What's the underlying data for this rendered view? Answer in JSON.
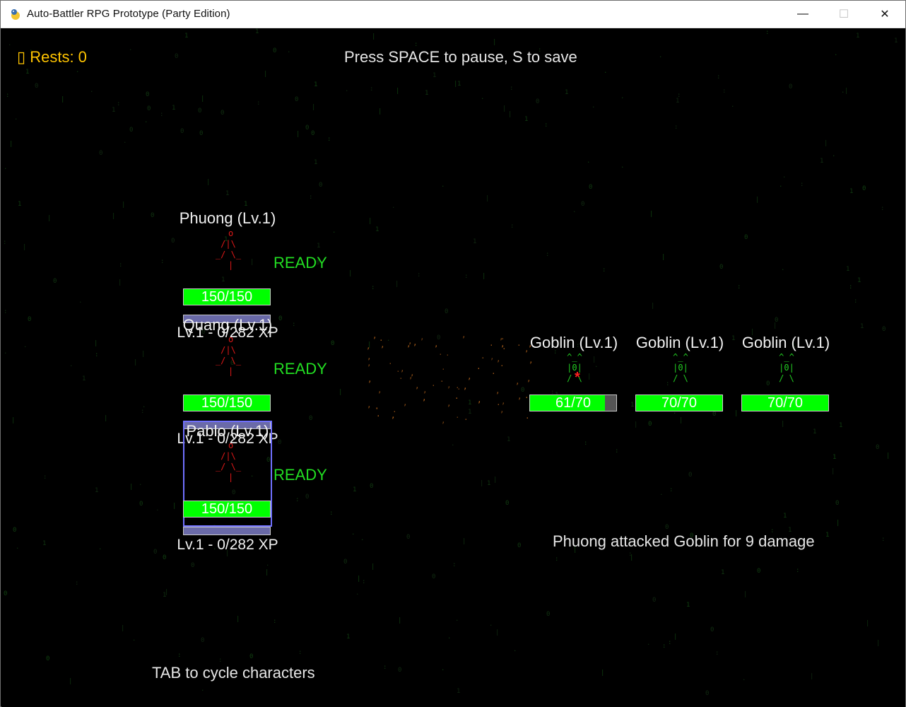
{
  "window": {
    "title": "Auto-Battler RPG Prototype (Party Edition)",
    "minimize": "—",
    "maximize": "☐",
    "close": "✕"
  },
  "hud": {
    "rests": "▯ Rests: 0",
    "controls_hint": "Press SPACE to pause, S to save",
    "tab_hint": "TAB to cycle characters"
  },
  "party": [
    {
      "name": "Phuong (Lv.1)",
      "status": "READY",
      "hp": "150/150",
      "hp_fraction": 1.0,
      "xp": "Lv.1 - 0/282 XP",
      "xp_fraction": 0.0,
      "selected": false
    },
    {
      "name": "Quang (Lv.1)",
      "status": "READY",
      "hp": "150/150",
      "hp_fraction": 1.0,
      "xp": "Lv.1 - 0/282 XP",
      "xp_fraction": 0.0,
      "selected": false
    },
    {
      "name": "Pablo (Lv.1)",
      "status": "READY",
      "hp": "150/150",
      "hp_fraction": 1.0,
      "xp": "Lv.1 - 0/282 XP",
      "xp_fraction": 0.0,
      "selected": true
    }
  ],
  "hero_sprite": " o\n/|\\\n_/ \\_\n |",
  "enemy_sprite": "^_^\n|0|\n/ \\",
  "enemies": [
    {
      "name": "Goblin (Lv.1)",
      "hp": "61/70",
      "hp_fraction": 0.871
    },
    {
      "name": "Goblin (Lv.1)",
      "hp": "70/70",
      "hp_fraction": 1.0
    },
    {
      "name": "Goblin (Lv.1)",
      "hp": "70/70",
      "hp_fraction": 1.0
    }
  ],
  "combat_log": "Phuong attacked Goblin for 9 damage",
  "hit_effect": "*",
  "colors": {
    "hp": "#00ff00",
    "ready": "#22dd22",
    "rests": "#ffc400",
    "selection": "#7070ff",
    "hero_sprite": "#e01818",
    "enemy_sprite": "#22cc22"
  }
}
